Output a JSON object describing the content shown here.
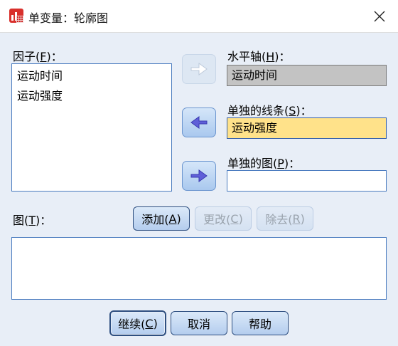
{
  "window": {
    "title": "单变量：轮廓图",
    "app_icon": "spss-chart-icon",
    "close_icon": "close-icon"
  },
  "factors": {
    "label": "因子(",
    "mnemonic": "F",
    "label_end": ")：",
    "items": [
      "运动时间",
      "运动强度"
    ]
  },
  "horizontal_axis": {
    "label": "水平轴(",
    "mnemonic": "H",
    "label_end": ")：",
    "value": "运动时间"
  },
  "separate_lines": {
    "label": "单独的线条(",
    "mnemonic": "S",
    "label_end": ")：",
    "value": "运动强度"
  },
  "separate_plots": {
    "label": "单独的图(",
    "mnemonic": "P",
    "label_end": ")：",
    "value": ""
  },
  "plots": {
    "label": "图(",
    "mnemonic": "T",
    "label_end": ")：",
    "add": {
      "label": "添加(",
      "mnemonic": "A",
      "label_end": ")"
    },
    "change": {
      "label": "更改(",
      "mnemonic": "C",
      "label_end": ")"
    },
    "remove": {
      "label": "除去(",
      "mnemonic": "R",
      "label_end": ")"
    },
    "items": []
  },
  "footer": {
    "continue": {
      "label": "继续(",
      "mnemonic": "C",
      "label_end": ")"
    },
    "cancel": "取消",
    "help": "帮助"
  },
  "colors": {
    "dialog_bg": "#e8eef7",
    "field_border": "#4a7bbf",
    "selected_field": "#ffe28a",
    "disabled_field": "#c3c3c3",
    "arrow_active": "#5f5fd8",
    "arrow_disabled": "#ffffff"
  }
}
